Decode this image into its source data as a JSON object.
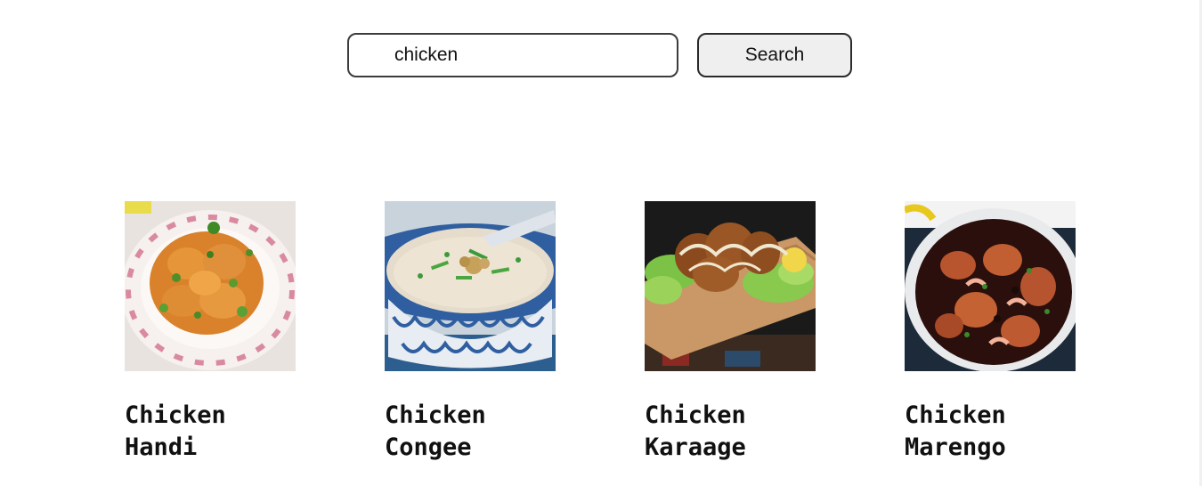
{
  "search": {
    "query": "chicken",
    "button_label": "Search"
  },
  "results": [
    {
      "title": "Chicken Handi",
      "image": "chicken-handi-photo"
    },
    {
      "title": "Chicken Congee",
      "image": "chicken-congee-photo"
    },
    {
      "title": "Chicken Karaage",
      "image": "chicken-karaage-photo"
    },
    {
      "title": "Chicken Marengo",
      "image": "chicken-marengo-photo"
    }
  ]
}
